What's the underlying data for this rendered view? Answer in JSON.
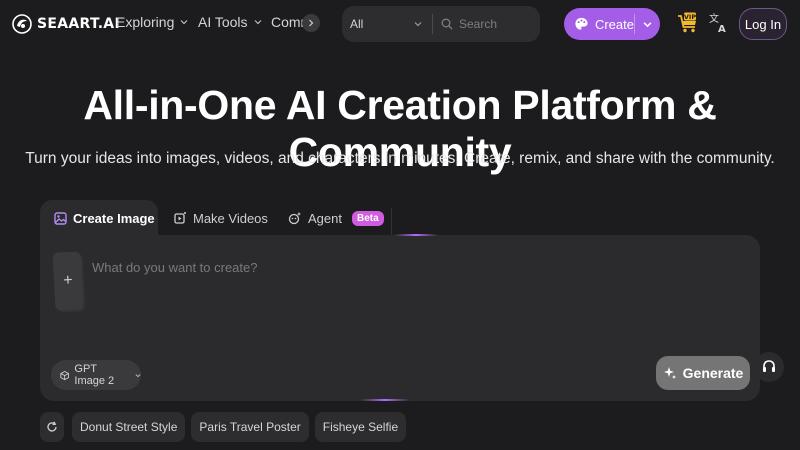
{
  "header": {
    "logo_text": "SEAART.AI",
    "nav": [
      {
        "label": "Exploring",
        "has_chevron": true
      },
      {
        "label": "AI Tools",
        "has_chevron": true
      },
      {
        "label": "Comm",
        "has_chevron": false
      }
    ],
    "search": {
      "category": "All",
      "placeholder": "Search"
    },
    "create_label": "Create",
    "login_label": "Log In",
    "icons": [
      "logo-icon",
      "chevron-down-icon",
      "chevron-right-icon",
      "search-icon",
      "palette-icon",
      "vip-cart-icon",
      "translate-icon"
    ]
  },
  "hero": {
    "title": "All-in-One AI Creation Platform & Community",
    "subtitle": "Turn your ideas into images, videos, and characters in minutes. Create, remix, and share with the community."
  },
  "tabs": [
    {
      "label": "Create Image",
      "icon": "image-icon",
      "active": true
    },
    {
      "label": "Make Videos",
      "icon": "video-icon",
      "active": false
    },
    {
      "label": "Agent",
      "icon": "agent-icon",
      "active": false,
      "badge": "Beta"
    }
  ],
  "prompt": {
    "placeholder": "What do you want to create?",
    "upload_symbol": "+",
    "model_label": "GPT Image 2",
    "generate_label": "Generate"
  },
  "suggestions": [
    "Donut Street Style",
    "Paris Travel Poster",
    "Fisheye Selfie"
  ],
  "colors": {
    "background": "#1c1c1e",
    "panel": "#2b2b2e",
    "accent": "#a45de6",
    "beta_badge": "#d05ce0",
    "generate_button": "#757575"
  }
}
